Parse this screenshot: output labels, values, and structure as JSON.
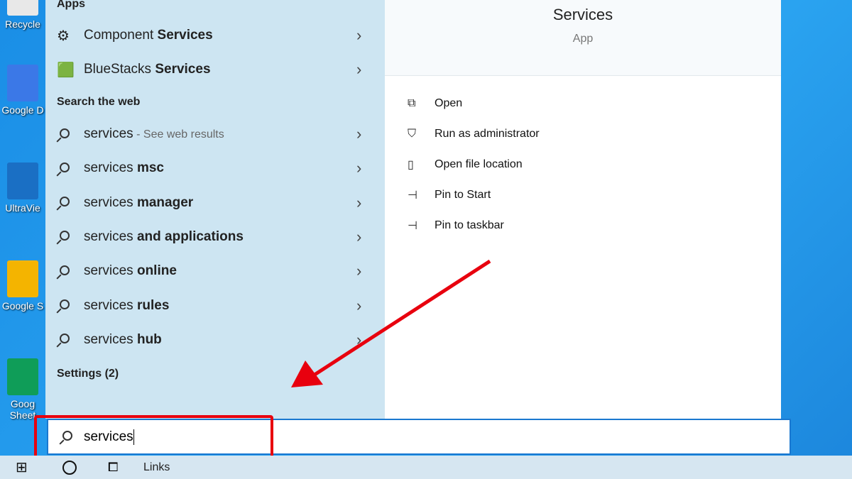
{
  "desktop": {
    "icons": [
      {
        "label": "Recycle",
        "color": "#e8e8e8"
      },
      {
        "label": "Google D",
        "color": "#3b78e7"
      },
      {
        "label": "UltraVie",
        "color": "#1a6fc4"
      },
      {
        "label": "Google S",
        "color": "#f4b400"
      },
      {
        "label": "Goog Sheet",
        "color": "#0f9d58"
      }
    ]
  },
  "left": {
    "apps_header": "Apps",
    "apps": [
      {
        "pre": "Component ",
        "bold": "Services"
      },
      {
        "pre": "BlueStacks ",
        "bold": "Services"
      }
    ],
    "web_header": "Search the web",
    "web": [
      {
        "pre": "services",
        "bold": "",
        "suffix": " - See web results"
      },
      {
        "pre": "services ",
        "bold": "msc"
      },
      {
        "pre": "services ",
        "bold": "manager"
      },
      {
        "pre": "services ",
        "bold": "and applications"
      },
      {
        "pre": "services ",
        "bold": "online"
      },
      {
        "pre": "services ",
        "bold": "rules"
      },
      {
        "pre": "services ",
        "bold": "hub"
      }
    ],
    "settings_header": "Settings (2)"
  },
  "right": {
    "title": "Services",
    "subtitle": "App",
    "actions": [
      {
        "label": "Open",
        "icon": "open-icon",
        "glyph": "⧉"
      },
      {
        "label": "Run as administrator",
        "icon": "shield-icon",
        "glyph": "⛉"
      },
      {
        "label": "Open file location",
        "icon": "file-location-icon",
        "glyph": "▯"
      },
      {
        "label": "Pin to Start",
        "icon": "pin-icon",
        "glyph": "⊣"
      },
      {
        "label": "Pin to taskbar",
        "icon": "pin-icon",
        "glyph": "⊣"
      }
    ]
  },
  "search": {
    "value": "services"
  },
  "taskbar": {
    "links_label": "Links"
  },
  "colors": {
    "annotation": "#e8000e",
    "accent": "#1a78d0"
  }
}
